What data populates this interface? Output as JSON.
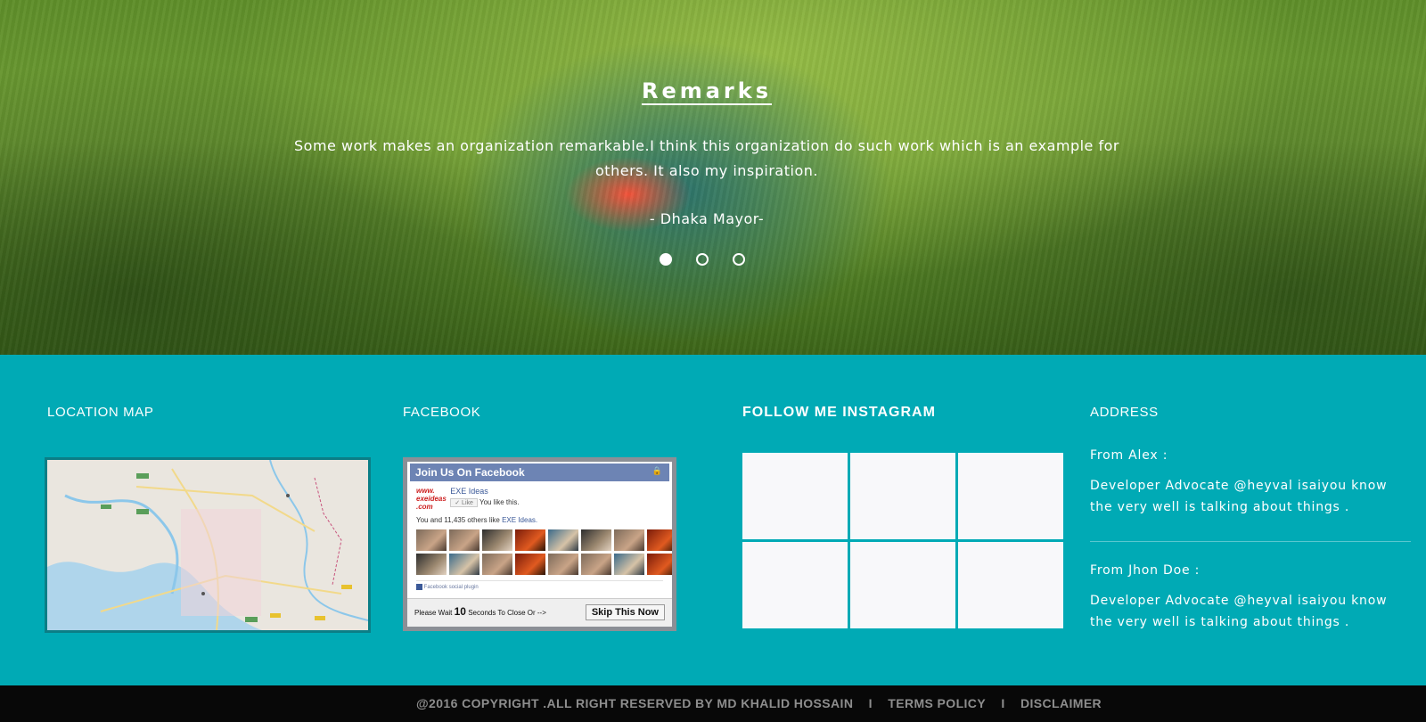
{
  "hero": {
    "title": "Remarks",
    "quote": "Some work makes an organization remarkable.I think this organization do such work which is an example for others. It also my inspiration.",
    "author": "- Dhaka Mayor-",
    "slides": 3,
    "active_slide": 1
  },
  "footer": {
    "location": {
      "title": "LOCATION MAP"
    },
    "facebook": {
      "title": "FACEBOOK",
      "widget": {
        "header": "Join Us On Facebook",
        "logo_line1": "www.",
        "logo_line2": "exeideas",
        "logo_line3": ".com",
        "page_name": "EXE Ideas",
        "like_label": "Like",
        "you_like": "You like this.",
        "others": "You and 11,435 others like",
        "others_page": "EXE Ideas.",
        "plugin_label": "Facebook social plugin",
        "wait_prefix": "Please Wait",
        "wait_seconds": "10",
        "wait_suffix": "Seconds To Close Or -->",
        "skip_button": "Skip This Now"
      }
    },
    "instagram": {
      "title": "FOLLOW ME INSTAGRAM",
      "tiles": 6
    },
    "address": {
      "title": "ADDRESS",
      "entries": [
        {
          "from": "From Alex :",
          "text": "Developer Advocate @heyval isaiyou know the very well is talking about things ."
        },
        {
          "from": "From Jhon Doe :",
          "text": "Developer Advocate @heyval isaiyou know the very well is talking about things ."
        }
      ]
    }
  },
  "bottom_bar": {
    "copyright": "@2016 COPYRIGHT .ALL RIGHT RESERVED BY MD KHALID HOSSAIN",
    "separator": "I",
    "terms": "TERMS POLICY",
    "disclaimer": "DISCLAIMER"
  },
  "colors": {
    "teal": "#00aab5",
    "bar": "#080808",
    "bar_text": "#8d8d8d"
  }
}
